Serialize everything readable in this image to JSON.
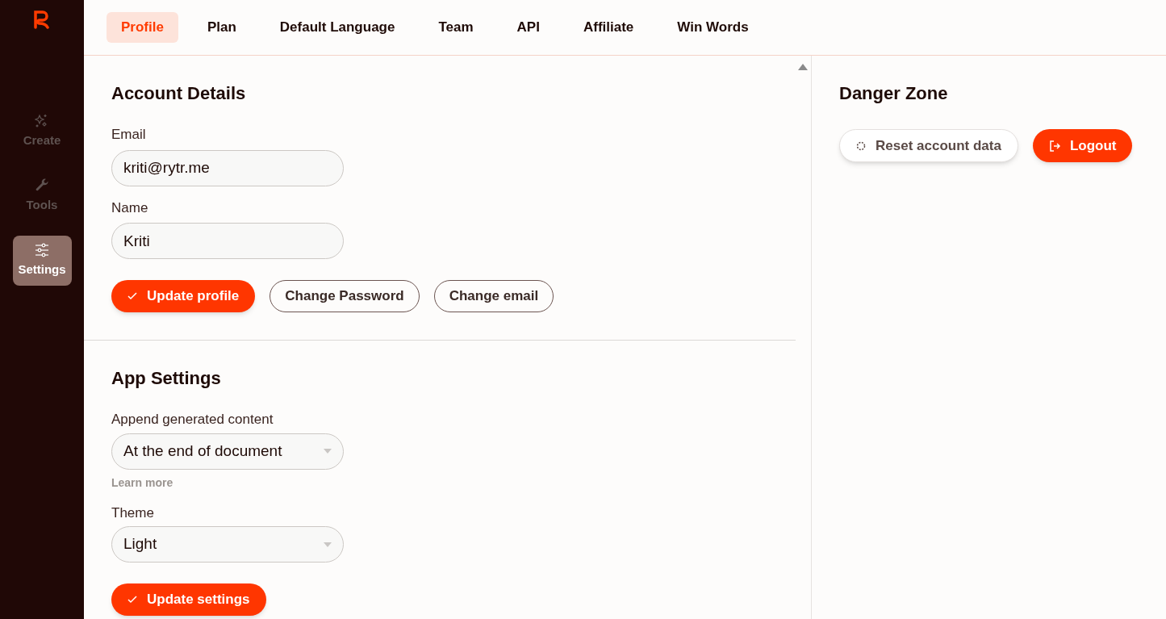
{
  "sidebar": {
    "items": [
      {
        "kind": "create",
        "label": "Create",
        "selected": false
      },
      {
        "kind": "tools",
        "label": "Tools",
        "selected": false
      },
      {
        "kind": "settings",
        "label": "Settings",
        "selected": true
      }
    ]
  },
  "tabs": [
    {
      "label": "Profile",
      "selected": true
    },
    {
      "label": "Plan",
      "selected": false
    },
    {
      "label": "Default Language",
      "selected": false
    },
    {
      "label": "Team",
      "selected": false
    },
    {
      "label": "API",
      "selected": false
    },
    {
      "label": "Affiliate",
      "selected": false
    },
    {
      "label": "Win Words",
      "selected": false
    }
  ],
  "account": {
    "title": "Account Details",
    "fields": [
      {
        "label": "Email",
        "value": "kriti@rytr.me"
      },
      {
        "label": "Name",
        "value": "Kriti"
      }
    ],
    "buttons": [
      {
        "kind": "primary",
        "label": "Update profile"
      },
      {
        "kind": "outline",
        "label": "Change Password"
      },
      {
        "kind": "outline",
        "label": "Change email"
      }
    ]
  },
  "app_settings": {
    "title": "App Settings",
    "selects": [
      {
        "label": "Append generated content",
        "value": "At the end of document",
        "help": "Learn more"
      },
      {
        "label": "Theme",
        "value": "Light"
      }
    ],
    "button": {
      "label": "Update settings"
    }
  },
  "danger": {
    "title": "Danger Zone",
    "buttons": [
      {
        "kind": "reset",
        "label": "Reset account data"
      },
      {
        "kind": "logout",
        "label": "Logout"
      }
    ]
  }
}
